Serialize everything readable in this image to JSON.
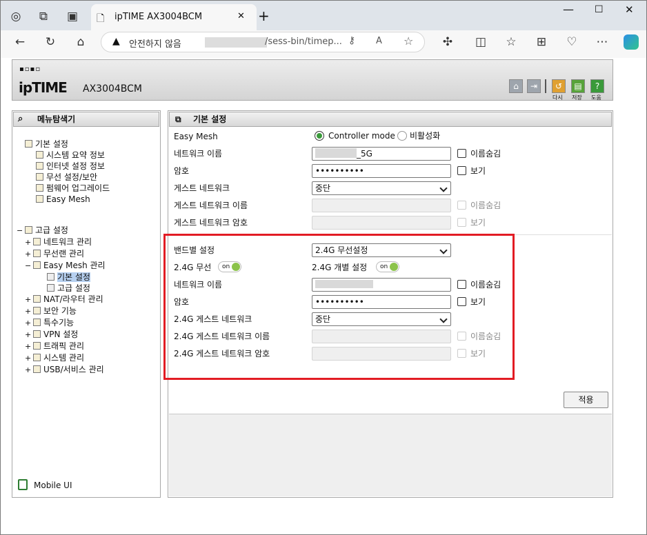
{
  "browser": {
    "tab_title": "ipTIME AX3004BCM",
    "address_security": "안전하지 않음",
    "address_url": "/sess-bin/timep...",
    "close_tab": "✕",
    "new_tab": "+"
  },
  "header": {
    "logo_small": "▪▫▪▫",
    "brand": "ipTIME",
    "model": "AX3004BCM",
    "btn_reset": "다시",
    "btn_save": "저장",
    "btn_help": "도움"
  },
  "left": {
    "title": "메뉴탐색기",
    "basic_group": "기본 설정",
    "basic_items": [
      "시스템 요약 정보",
      "인터넷 설정 정보",
      "무선 설정/보안",
      "펌웨어 업그레이드",
      "Easy Mesh"
    ],
    "adv_group": "고급 설정",
    "adv_items": [
      {
        "pm": "+",
        "label": "네트워크 관리"
      },
      {
        "pm": "+",
        "label": "무선랜 관리"
      },
      {
        "pm": "−",
        "label": "Easy Mesh 관리"
      }
    ],
    "mesh_sub": [
      "기본 설정",
      "고급 설정"
    ],
    "adv_items2": [
      {
        "pm": "+",
        "label": "NAT/라우터 관리"
      },
      {
        "pm": "+",
        "label": "보안 기능"
      },
      {
        "pm": "+",
        "label": "특수기능"
      },
      {
        "pm": "+",
        "label": "VPN 설정"
      },
      {
        "pm": "+",
        "label": "트래픽 관리"
      },
      {
        "pm": "+",
        "label": "시스템 관리"
      },
      {
        "pm": "+",
        "label": "USB/서비스 관리"
      }
    ],
    "mobile_ui": "Mobile UI"
  },
  "main": {
    "title": "기본 설정",
    "easy_mesh_label": "Easy Mesh",
    "mode_controller": "Controller mode",
    "mode_disabled": "비활성화",
    "net_name_label": "네트워크 이름",
    "net_name_value": "_5G",
    "password_label": "암호",
    "password_value": "••••••••••",
    "guest_label": "게스트 네트워크",
    "guest_value": "중단",
    "guest_name_label": "게스트 네트워크 이름",
    "guest_pw_label": "게스트 네트워크 암호",
    "hide_name": "이름숨김",
    "show": "보기",
    "band_label": "밴드별 설정",
    "band_value": "2.4G 무선설정",
    "wifi24_label": "2.4G 무선",
    "wifi24_toggle": "on",
    "indiv_label": "2.4G 개별 설정",
    "indiv_toggle": "on",
    "net_name2_label": "네트워크 이름",
    "password2_label": "암호",
    "password2_value": "••••••••••",
    "guest24_label": "2.4G 게스트 네트워크",
    "guest24_value": "중단",
    "guest24_name_label": "2.4G 게스트 네트워크 이름",
    "guest24_pw_label": "2.4G 게스트 네트워크 암호",
    "apply": "적용"
  },
  "colors": {
    "highlight_box": "#e21c24",
    "toggle_on": "#8bc34a"
  }
}
